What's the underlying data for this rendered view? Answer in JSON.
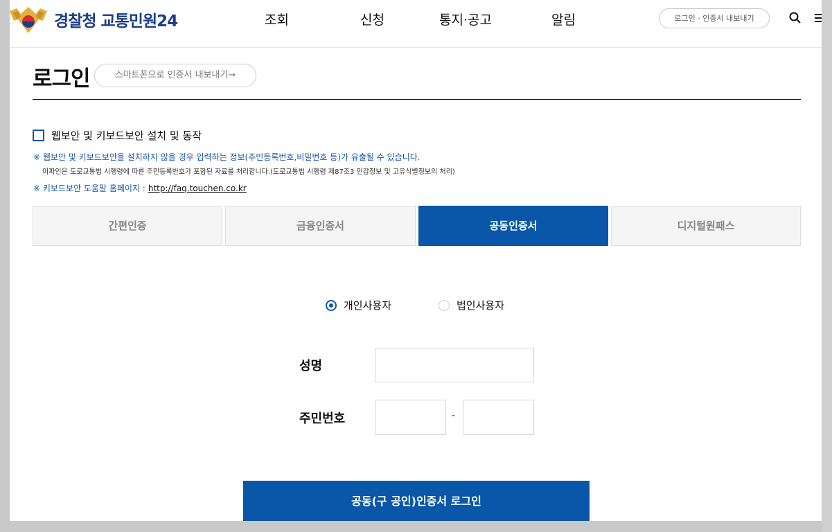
{
  "header": {
    "logo_text": "경찰청 교통민원24",
    "nav": [
      "조회",
      "신청",
      "통지·공고",
      "알림"
    ],
    "export_label": "로그인 · 인증서 내보내기",
    "search_icon": "search-icon",
    "menu_icon": "hamburger-menu-icon"
  },
  "page": {
    "title": "로그인",
    "smartphone_export": "스마트폰으로 인증서 내보내기→"
  },
  "security": {
    "checkbox_label": "웹보안 및 키보드보안 설치 및 동작",
    "checked": false,
    "notice1": "※ 웹보안 및 키보드보안을 설치하지 않을 경우 입력하는 정보(주민등록번호,비밀번호 등)가 유출될 수 있습니다.",
    "notice2": "이파인은 도로교통법 시행령에 따른 주민등록번호가 포함된 자료를 처리합니다.(도로교통법 시행령 제87조3 민감정보 및 고유식별정보의 처리)",
    "notice3_prefix": "※ 키보드보안 도움말 홈페이지 :",
    "notice3_link": "http://faq.touchen.co.kr"
  },
  "tabs": [
    {
      "label": "간편인증",
      "active": false
    },
    {
      "label": "금융인증서",
      "active": false
    },
    {
      "label": "공동인증서",
      "active": true
    },
    {
      "label": "디지털원패스",
      "active": false
    }
  ],
  "user_type": {
    "options": [
      "개인사용자",
      "법인사용자"
    ],
    "selected": "개인사용자"
  },
  "form": {
    "name_label": "성명",
    "name_value": "",
    "rrn_label": "주민번호",
    "rrn_front_value": "",
    "rrn_back_value": "",
    "separator": "-"
  },
  "submit_label": "공동(구 공인)인증서 로그인",
  "colors": {
    "primary": "#0a56a8",
    "logo": "#1a3e8c",
    "notice": "#1a56a8"
  }
}
